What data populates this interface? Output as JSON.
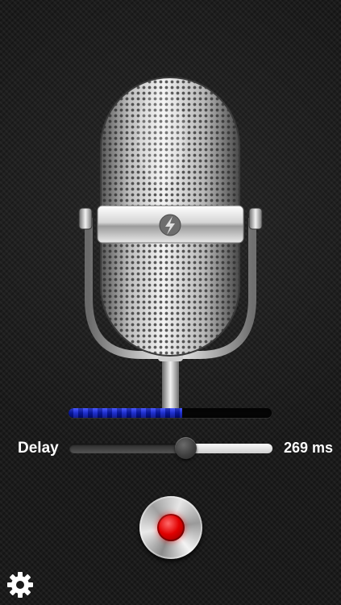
{
  "microphone": {
    "icon": "lightning-bolt-icon"
  },
  "level_meter": {
    "level": 0.56,
    "color": "#1428ff"
  },
  "delay": {
    "label": "Delay",
    "value_text": "269 ms",
    "slider_fraction": 0.57
  },
  "record_button": {
    "icon": "record-icon",
    "color": "#e10000"
  },
  "settings": {
    "icon": "gear-icon"
  }
}
